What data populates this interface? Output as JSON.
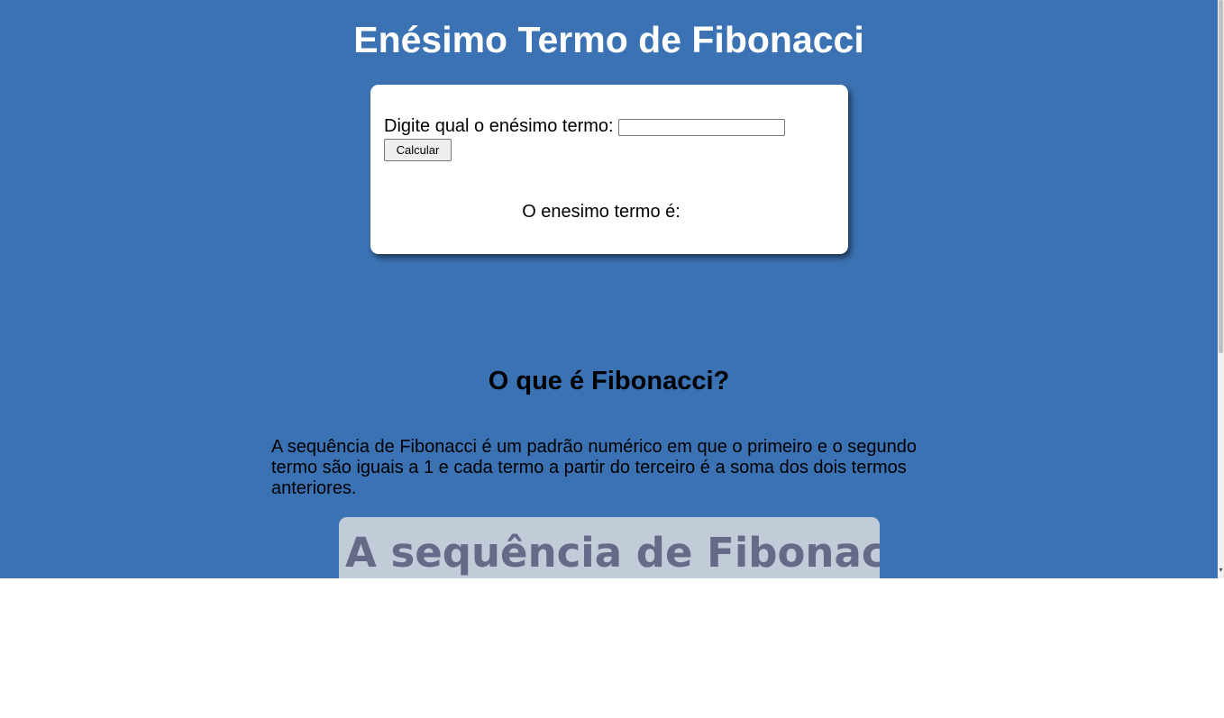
{
  "header": {
    "title": "Enésimo Termo de Fibonacci"
  },
  "calculator": {
    "prompt_label": "Digite qual o enésimo termo:",
    "input_value": "",
    "button_label": "Calcular",
    "result_label": "O enesimo termo é:"
  },
  "info": {
    "heading": "O que é Fibonacci?",
    "description": "A sequência de Fibonacci é um padrão numérico em que o primeiro e o segundo termo são iguais a 1 e cada termo a partir do terceiro é a soma dos dois termos anteriores.",
    "image_caption": "A sequência de Fibonacci"
  },
  "colors": {
    "page_background": "#3b72b4",
    "card_background": "#ffffff",
    "image_background": "#c2ccd8",
    "image_text": "#666a88"
  }
}
